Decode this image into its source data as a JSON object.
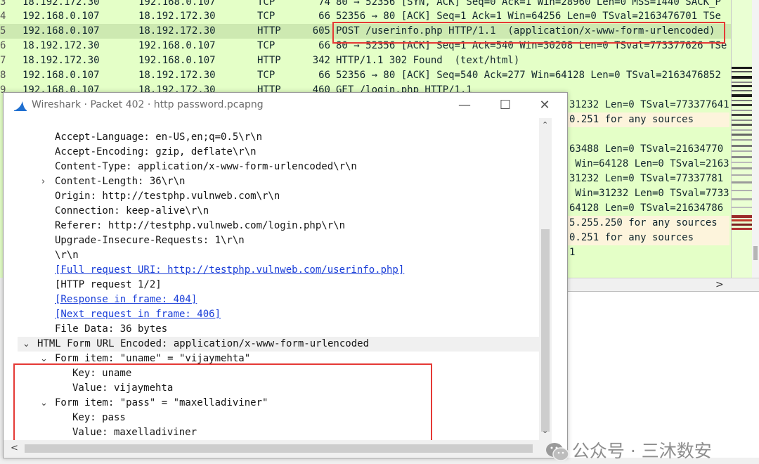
{
  "packets": [
    {
      "num": "3",
      "src": "18.192.172.30",
      "dst": "192.168.0.107",
      "proto": "TCP",
      "len": "74",
      "info": "80 → 52356 [SYN, ACK] Seq=0 Ack=1 Win=28960 Len=0 MSS=1440 SACK_P",
      "selected": false
    },
    {
      "num": "4",
      "src": "192.168.0.107",
      "dst": "18.192.172.30",
      "proto": "TCP",
      "len": "66",
      "info": "52356 → 80 [ACK] Seq=1 Ack=1 Win=64256 Len=0 TSval=2163476701 TSe",
      "selected": false
    },
    {
      "num": "5",
      "src": "192.168.0.107",
      "dst": "18.192.172.30",
      "proto": "HTTP",
      "len": "605",
      "info": "POST /userinfo.php HTTP/1.1  (application/x-www-form-urlencoded)",
      "selected": true
    },
    {
      "num": "6",
      "src": "18.192.172.30",
      "dst": "192.168.0.107",
      "proto": "TCP",
      "len": "66",
      "info": "80 → 52356 [ACK] Seq=1 Ack=540 Win=30208 Len=0 TSval=773377626 TSe",
      "selected": false
    },
    {
      "num": "7",
      "src": "18.192.172.30",
      "dst": "192.168.0.107",
      "proto": "HTTP",
      "len": "342",
      "info": "HTTP/1.1 302 Found  (text/html)",
      "selected": false
    },
    {
      "num": "8",
      "src": "192.168.0.107",
      "dst": "18.192.172.30",
      "proto": "TCP",
      "len": "66",
      "info": "52356 → 80 [ACK] Seq=540 Ack=277 Win=64128 Len=0 TSval=2163476852",
      "selected": false
    },
    {
      "num": "9",
      "src": "192.168.0.107",
      "dst": "18.192.172.30",
      "proto": "HTTP",
      "len": "460",
      "info": "GET /login.php HTTP/1.1",
      "selected": false
    }
  ],
  "visible_fragments": [
    "31232 Len=0 TSval=773377641",
    "0.251 for any sources",
    "",
    "63488 Len=0 TSval=21634770",
    " Win=64128 Len=0 TSval=2163",
    "31232 Len=0 TSval=77337781",
    " Win=31232 Len=0 TSval=7733",
    "64128 Len=0 TSval=21634786",
    "5.255.250 for any sources",
    "0.251 for any sources",
    "1"
  ],
  "window": {
    "title": "Wireshark · Packet 402 · http password.pcapng",
    "min_glyph": "—",
    "max_glyph": "☐",
    "close_glyph": "✕"
  },
  "tree_lines": [
    "Accept-Language: en-US,en;q=0.5\\r\\n",
    "Accept-Encoding: gzip, deflate\\r\\n",
    "Content-Type: application/x-www-form-urlencoded\\r\\n",
    "Content-Length: 36\\r\\n",
    "Origin: http://testphp.vulnweb.com\\r\\n",
    "Connection: keep-alive\\r\\n",
    "Referer: http://testphp.vulnweb.com/login.php\\r\\n",
    "Upgrade-Insecure-Requests: 1\\r\\n",
    "\\r\\n",
    "[Full request URI: http://testphp.vulnweb.com/userinfo.php]",
    "[HTTP request 1/2]",
    "[Response in frame: 404]",
    "[Next request in frame: 406]",
    "File Data: 36 bytes",
    "HTML Form URL Encoded: application/x-www-form-urlencoded",
    "Form item: \"uname\" = \"vijaymehta\"",
    "Key: uname",
    "Value: vijaymehta",
    "Form item: \"pass\" = \"maxelladiviner\"",
    "Key: pass",
    "Value: maxelladiviner"
  ],
  "glyphs": {
    "collapsed": "›",
    "expanded": "⌄",
    "scroll_up": "⌃",
    "scroll_down": "⌄",
    "scroll_left": "<",
    "scroll_right": ">"
  },
  "watermark": "公众号 · 三沐数安",
  "colors": {
    "tcp_row_bg": "#e4ffc7",
    "selected_row_bg": "#cde9b1",
    "highlight_box": "#e53935",
    "link": "#1a3ed8",
    "yellow_row_bg": "#fdf4dc"
  },
  "icons": {
    "window_icon": "wireshark-fin-icon",
    "watermark_icon": "wechat-icon"
  }
}
